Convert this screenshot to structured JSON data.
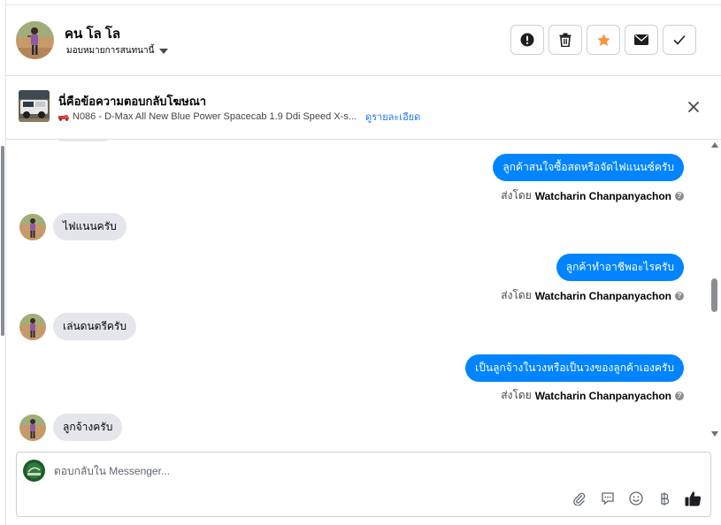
{
  "contact": {
    "name": "คน โล โล",
    "assign_label": "มอบหมายการสนทนานี้"
  },
  "actions": [
    {
      "name": "spam-button",
      "icon": "exclamation-icon"
    },
    {
      "name": "delete-button",
      "icon": "trash-icon"
    },
    {
      "name": "star-button",
      "icon": "star-icon",
      "color": "#f7923b"
    },
    {
      "name": "mark-unread-button",
      "icon": "envelope-icon"
    },
    {
      "name": "mark-done-button",
      "icon": "check-icon"
    }
  ],
  "ad_reply": {
    "title": "นี่คือข้อความตอบกลับโฆษณา",
    "post_icon": "pickup-truck-icon",
    "post_text": "N086 - D-Max All New Blue Power Spacecab 1.9 Ddi Speed X-s...",
    "details_link": "ดูรายละเอียด"
  },
  "messages": [
    {
      "direction": "outgoing",
      "text": "ลูกค้าสนใจซื้อสดหรือจัดไฟแนนซ์ครับ",
      "sent_by_prefix": "ส่งโดย",
      "sender": "Watcharin Chanpanyachon"
    },
    {
      "direction": "incoming",
      "text": "ไฟแนนครับ"
    },
    {
      "direction": "outgoing",
      "text": "ลูกค้าทำอาชีพอะไรครับ",
      "sent_by_prefix": "ส่งโดย",
      "sender": "Watcharin Chanpanyachon"
    },
    {
      "direction": "incoming",
      "text": "เล่นดนตรีครับ"
    },
    {
      "direction": "outgoing",
      "text": "เป็นลูกจ้างในวงหรือเป็นวงของลูกค้าเองครับ",
      "sent_by_prefix": "ส่งโดย",
      "sender": "Watcharin Chanpanyachon"
    },
    {
      "direction": "incoming",
      "text": "ลูกจ้างครับ"
    }
  ],
  "composer": {
    "placeholder": "ตอบกลับใน Messenger...",
    "tools": [
      "paperclip-icon",
      "saved-reply-icon",
      "emoji-icon",
      "baht-icon",
      "thumbs-up-icon"
    ]
  },
  "colors": {
    "outgoing_bubble": "#0084ff",
    "incoming_bubble": "#e4e6eb",
    "link": "#1877f2",
    "star": "#f7923b"
  }
}
